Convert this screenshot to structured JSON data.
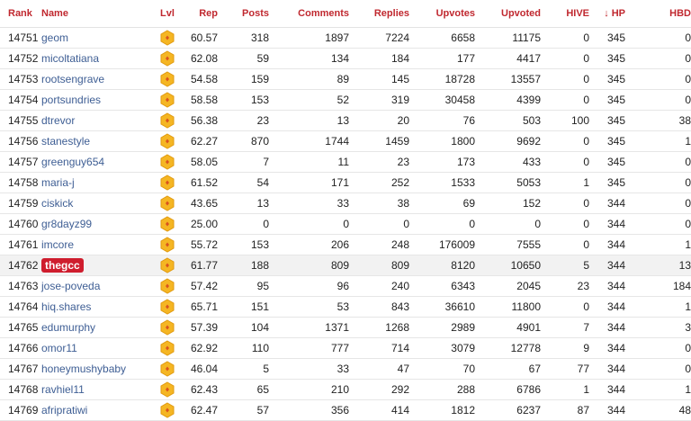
{
  "columns": {
    "rank": "Rank",
    "name": "Name",
    "lvl": "Lvl",
    "rep": "Rep",
    "posts": "Posts",
    "comments": "Comments",
    "replies": "Replies",
    "upvotes": "Upvotes",
    "upvoted": "Upvoted",
    "hive": "HIVE",
    "hp": "HP",
    "hbd": "HBD"
  },
  "sort": {
    "column": "HP",
    "direction": "descending",
    "arrow": "↓"
  },
  "level_icon": "hexagon-badge-icon",
  "colors": {
    "header": "#c0282f",
    "link": "#3e5e94",
    "highlight_badge": "#cf1d2e",
    "hex_badge": "#f5b623"
  },
  "highlighted_user": "thegcc",
  "rows": [
    {
      "rank": "14751",
      "name": "geom",
      "rep": "60.57",
      "posts": "318",
      "comments": "1897",
      "replies": "7224",
      "upvotes": "6658",
      "upvoted": "11175",
      "hive": "0",
      "hp": "345",
      "hbd": "0"
    },
    {
      "rank": "14752",
      "name": "micoltatiana",
      "rep": "62.08",
      "posts": "59",
      "comments": "134",
      "replies": "184",
      "upvotes": "177",
      "upvoted": "4417",
      "hive": "0",
      "hp": "345",
      "hbd": "0"
    },
    {
      "rank": "14753",
      "name": "rootsengrave",
      "rep": "54.58",
      "posts": "159",
      "comments": "89",
      "replies": "145",
      "upvotes": "18728",
      "upvoted": "13557",
      "hive": "0",
      "hp": "345",
      "hbd": "0"
    },
    {
      "rank": "14754",
      "name": "portsundries",
      "rep": "58.58",
      "posts": "153",
      "comments": "52",
      "replies": "319",
      "upvotes": "30458",
      "upvoted": "4399",
      "hive": "0",
      "hp": "345",
      "hbd": "0"
    },
    {
      "rank": "14755",
      "name": "dtrevor",
      "rep": "56.38",
      "posts": "23",
      "comments": "13",
      "replies": "20",
      "upvotes": "76",
      "upvoted": "503",
      "hive": "100",
      "hp": "345",
      "hbd": "38"
    },
    {
      "rank": "14756",
      "name": "stanestyle",
      "rep": "62.27",
      "posts": "870",
      "comments": "1744",
      "replies": "1459",
      "upvotes": "1800",
      "upvoted": "9692",
      "hive": "0",
      "hp": "345",
      "hbd": "1"
    },
    {
      "rank": "14757",
      "name": "greenguy654",
      "rep": "58.05",
      "posts": "7",
      "comments": "11",
      "replies": "23",
      "upvotes": "173",
      "upvoted": "433",
      "hive": "0",
      "hp": "345",
      "hbd": "0"
    },
    {
      "rank": "14758",
      "name": "maria-j",
      "rep": "61.52",
      "posts": "54",
      "comments": "171",
      "replies": "252",
      "upvotes": "1533",
      "upvoted": "5053",
      "hive": "1",
      "hp": "345",
      "hbd": "0"
    },
    {
      "rank": "14759",
      "name": "ciskick",
      "rep": "43.65",
      "posts": "13",
      "comments": "33",
      "replies": "38",
      "upvotes": "69",
      "upvoted": "152",
      "hive": "0",
      "hp": "344",
      "hbd": "0"
    },
    {
      "rank": "14760",
      "name": "gr8dayz99",
      "rep": "25.00",
      "posts": "0",
      "comments": "0",
      "replies": "0",
      "upvotes": "0",
      "upvoted": "0",
      "hive": "0",
      "hp": "344",
      "hbd": "0"
    },
    {
      "rank": "14761",
      "name": "imcore",
      "rep": "55.72",
      "posts": "153",
      "comments": "206",
      "replies": "248",
      "upvotes": "176009",
      "upvoted": "7555",
      "hive": "0",
      "hp": "344",
      "hbd": "1"
    },
    {
      "rank": "14762",
      "name": "thegcc",
      "rep": "61.77",
      "posts": "188",
      "comments": "809",
      "replies": "809",
      "upvotes": "8120",
      "upvoted": "10650",
      "hive": "5",
      "hp": "344",
      "hbd": "13",
      "highlight": true
    },
    {
      "rank": "14763",
      "name": "jose-poveda",
      "rep": "57.42",
      "posts": "95",
      "comments": "96",
      "replies": "240",
      "upvotes": "6343",
      "upvoted": "2045",
      "hive": "23",
      "hp": "344",
      "hbd": "184"
    },
    {
      "rank": "14764",
      "name": "hiq.shares",
      "rep": "65.71",
      "posts": "151",
      "comments": "53",
      "replies": "843",
      "upvotes": "36610",
      "upvoted": "11800",
      "hive": "0",
      "hp": "344",
      "hbd": "1"
    },
    {
      "rank": "14765",
      "name": "edumurphy",
      "rep": "57.39",
      "posts": "104",
      "comments": "1371",
      "replies": "1268",
      "upvotes": "2989",
      "upvoted": "4901",
      "hive": "7",
      "hp": "344",
      "hbd": "3"
    },
    {
      "rank": "14766",
      "name": "omor11",
      "rep": "62.92",
      "posts": "110",
      "comments": "777",
      "replies": "714",
      "upvotes": "3079",
      "upvoted": "12778",
      "hive": "9",
      "hp": "344",
      "hbd": "0"
    },
    {
      "rank": "14767",
      "name": "honeymushybaby",
      "rep": "46.04",
      "posts": "5",
      "comments": "33",
      "replies": "47",
      "upvotes": "70",
      "upvoted": "67",
      "hive": "77",
      "hp": "344",
      "hbd": "0"
    },
    {
      "rank": "14768",
      "name": "ravhiel11",
      "rep": "62.43",
      "posts": "65",
      "comments": "210",
      "replies": "292",
      "upvotes": "288",
      "upvoted": "6786",
      "hive": "1",
      "hp": "344",
      "hbd": "1"
    },
    {
      "rank": "14769",
      "name": "afripratiwi",
      "rep": "62.47",
      "posts": "57",
      "comments": "356",
      "replies": "414",
      "upvotes": "1812",
      "upvoted": "6237",
      "hive": "87",
      "hp": "344",
      "hbd": "48"
    }
  ]
}
